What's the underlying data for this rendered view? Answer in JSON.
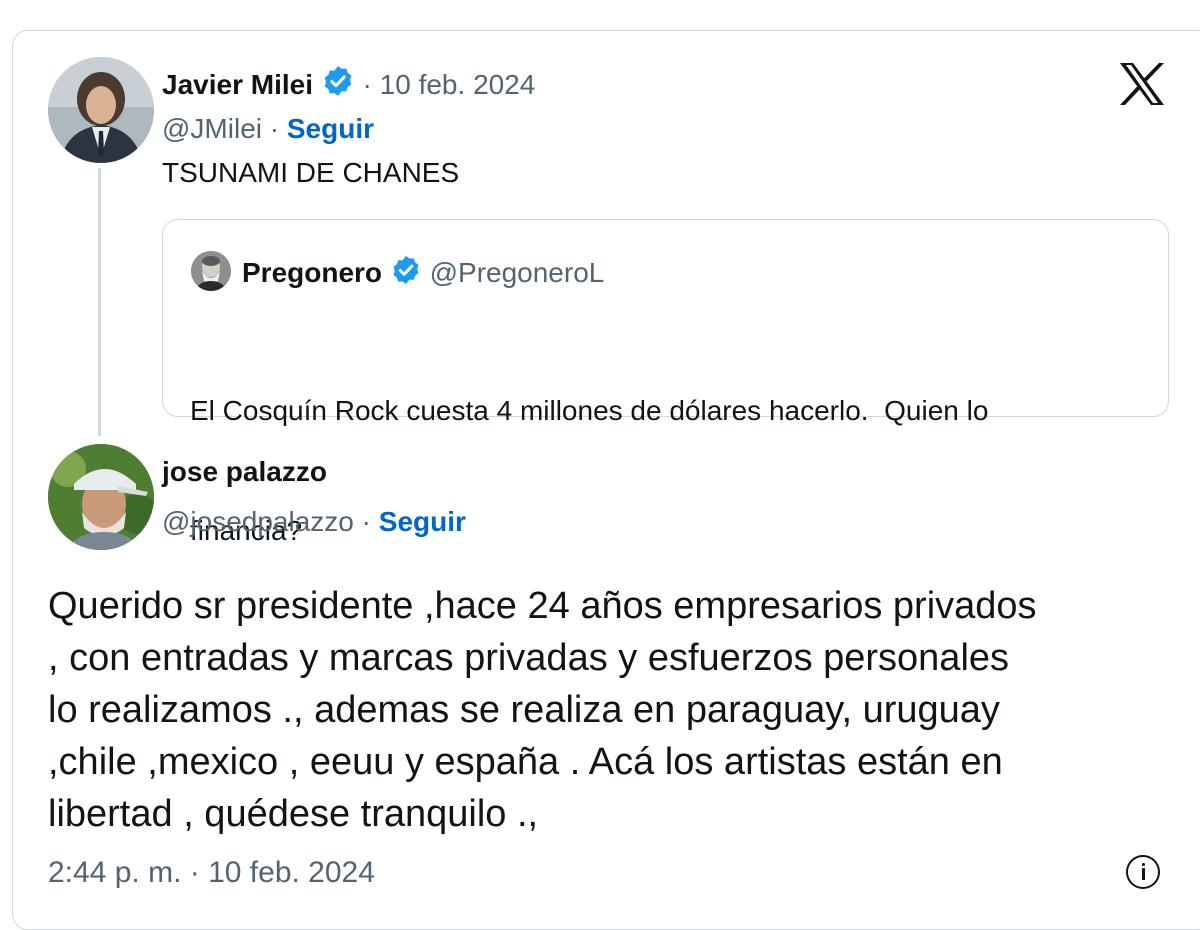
{
  "tweet": {
    "author_name": "Javier Milei",
    "separator": "·",
    "date": "10 feb. 2024",
    "handle": "@JMilei",
    "follow_label": "Seguir",
    "text": "TSUNAMI DE CHANES"
  },
  "quoted": {
    "author_name": "Pregonero",
    "handle": "@PregoneroL",
    "text_line1": "El Cosquín Rock cuesta 4 millones de dólares hacerlo.  Quien lo",
    "text_line2": "financia?"
  },
  "reply": {
    "author_name": "jose palazzo",
    "handle": "@josedpalazzo",
    "follow_label": "Seguir",
    "lines": [
      "Querido sr presidente ,hace 24 años empresarios privados",
      ", con entradas y marcas privadas y esfuerzos personales",
      "lo realizamos ., ademas se realiza en paraguay, uruguay",
      ",chile ,mexico , eeuu y españa . Acá los artistas están en",
      "libertad , quédese tranquilo .,"
    ],
    "time": "2:44 p. m.",
    "date": "10 feb. 2024"
  },
  "icons": {
    "verified": "verified-badge-icon",
    "platform": "x-logo-icon",
    "info": "info-icon"
  },
  "colors": {
    "accent": "#0066cc",
    "verified": "#1d9bf0",
    "muted": "#536471",
    "border": "#cfd9de"
  }
}
